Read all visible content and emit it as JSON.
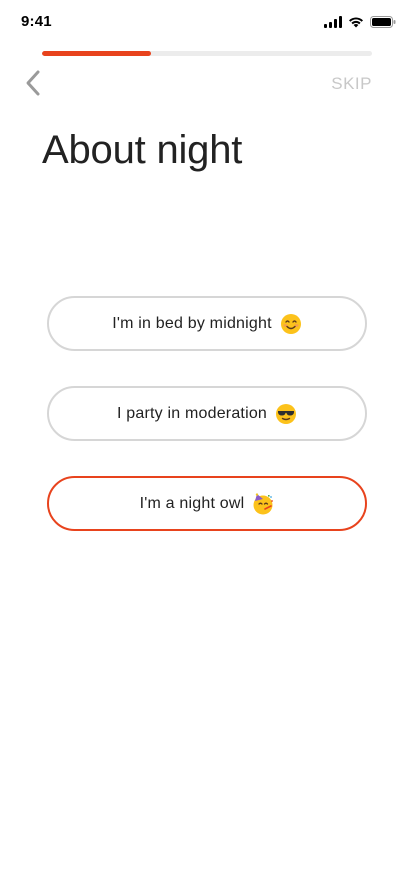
{
  "status_bar": {
    "time": "9:41",
    "icons": [
      "cellular-signal-icon",
      "wifi-icon",
      "battery-icon"
    ]
  },
  "progress": {
    "value": 0.33
  },
  "nav": {
    "back_icon": "chevron-left-icon",
    "skip_label": "SKIP"
  },
  "page": {
    "title": "About night"
  },
  "options": [
    {
      "label": "I'm in bed by midnight",
      "emoji": "smiling-face-icon",
      "selected": false
    },
    {
      "label": "I party in moderation",
      "emoji": "sunglasses-face-icon",
      "selected": false
    },
    {
      "label": "I'm a night owl",
      "emoji": "party-face-icon",
      "selected": true
    }
  ],
  "colors": {
    "accent": "#e8431d",
    "border": "#d6d6d6",
    "skip": "#c8c8c8",
    "track": "#ececec"
  }
}
